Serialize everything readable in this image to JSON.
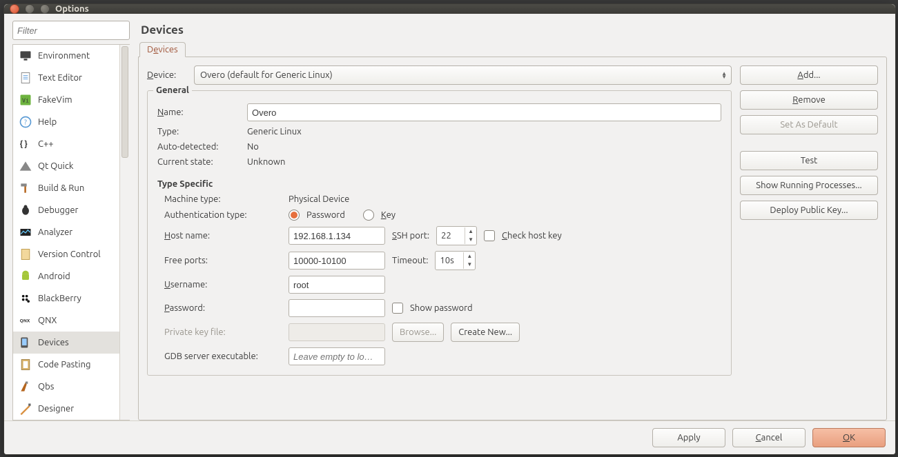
{
  "window": {
    "title": "Options"
  },
  "filter": {
    "placeholder": "Filter"
  },
  "categories": [
    {
      "label": "Environment",
      "icon": "monitor-icon"
    },
    {
      "label": "Text Editor",
      "icon": "document-icon"
    },
    {
      "label": "FakeVim",
      "icon": "fakevim-icon"
    },
    {
      "label": "Help",
      "icon": "help-icon"
    },
    {
      "label": "C++",
      "icon": "cpp-icon"
    },
    {
      "label": "Qt Quick",
      "icon": "qtquick-icon"
    },
    {
      "label": "Build & Run",
      "icon": "hammer-icon"
    },
    {
      "label": "Debugger",
      "icon": "bug-icon"
    },
    {
      "label": "Analyzer",
      "icon": "analyzer-icon"
    },
    {
      "label": "Version Control",
      "icon": "vcs-icon"
    },
    {
      "label": "Android",
      "icon": "android-icon"
    },
    {
      "label": "BlackBerry",
      "icon": "blackberry-icon"
    },
    {
      "label": "QNX",
      "icon": "qnx-icon"
    },
    {
      "label": "Devices",
      "icon": "devices-icon",
      "selected": true
    },
    {
      "label": "Code Pasting",
      "icon": "paste-icon"
    },
    {
      "label": "Qbs",
      "icon": "qbs-icon"
    },
    {
      "label": "Designer",
      "icon": "designer-icon"
    }
  ],
  "page": {
    "title": "Devices",
    "tab_label": "Devices",
    "device_label": "Device:",
    "device_value": "Overo (default for Generic Linux)"
  },
  "sidebuttons": {
    "add": "Add...",
    "remove": "Remove",
    "set_default": "Set As Default",
    "test": "Test",
    "show_processes": "Show Running Processes...",
    "deploy_key": "Deploy Public Key..."
  },
  "general": {
    "legend": "General",
    "name_label": "Name:",
    "name_value": "Overo",
    "type_label": "Type:",
    "type_value": "Generic Linux",
    "autodetected_label": "Auto-detected:",
    "autodetected_value": "No",
    "state_label": "Current state:",
    "state_value": "Unknown"
  },
  "ts": {
    "legend": "Type Specific",
    "machine_type_label": "Machine type:",
    "machine_type_value": "Physical Device",
    "auth_type_label": "Authentication type:",
    "auth_password": "Password",
    "auth_key": "Key",
    "auth_selected": "password",
    "host_label": "Host name:",
    "host_value": "192.168.1.134",
    "ssh_port_label": "SSH port:",
    "ssh_port_value": "22",
    "check_host_key_label": "Check host key",
    "check_host_key_checked": false,
    "free_ports_label": "Free ports:",
    "free_ports_value": "10000-10100",
    "timeout_label": "Timeout:",
    "timeout_value": "10s",
    "username_label": "Username:",
    "username_value": "root",
    "password_label": "Password:",
    "password_value": "",
    "show_password_label": "Show password",
    "show_password_checked": false,
    "pkey_label": "Private key file:",
    "browse": "Browse...",
    "create_new": "Create New...",
    "gdb_label": "GDB server executable:",
    "gdb_placeholder": "Leave empty to lo…"
  },
  "footer": {
    "apply": "Apply",
    "cancel": "Cancel",
    "ok": "OK"
  }
}
